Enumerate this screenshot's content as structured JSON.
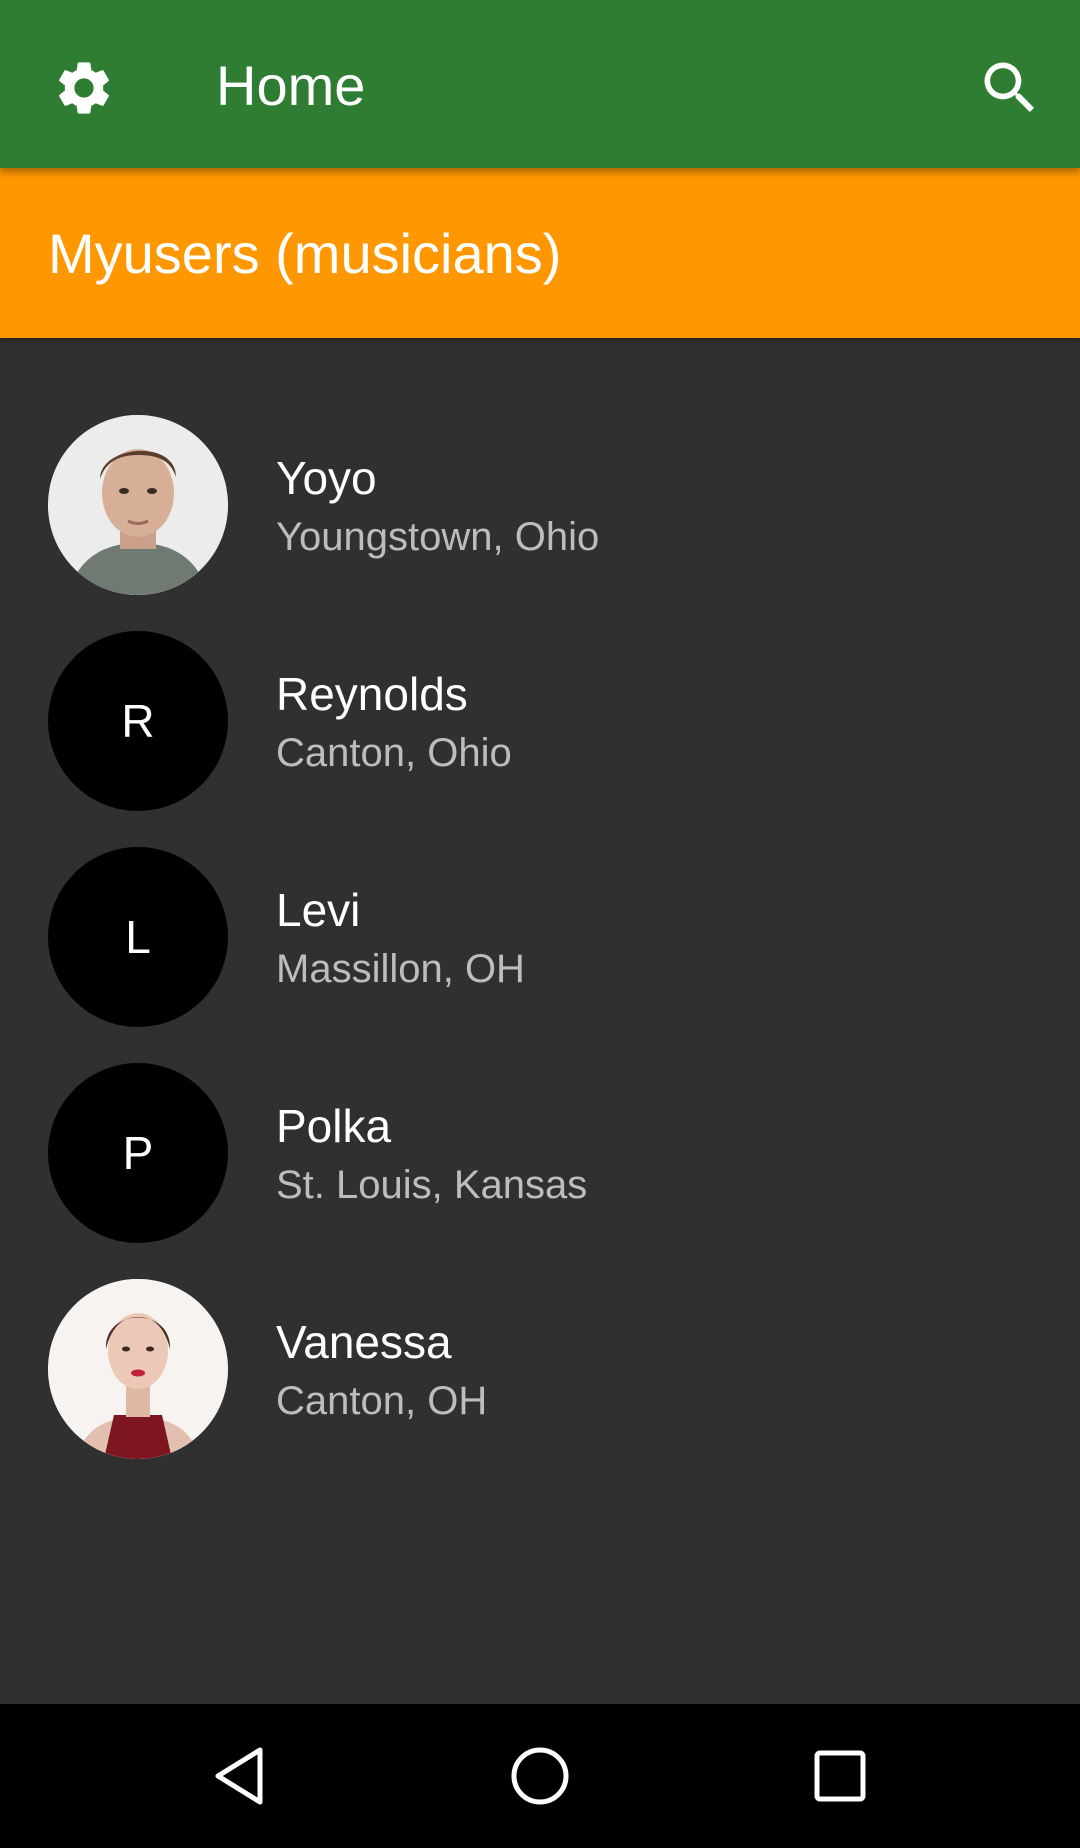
{
  "app_bar": {
    "title": "Home",
    "settings_icon": "gear-icon",
    "search_icon": "search-icon",
    "color": "#2e7d32"
  },
  "header": {
    "title": "Myusers (musicians)",
    "color": "#ff9800"
  },
  "users": [
    {
      "name": "Yoyo",
      "location": "Youngstown, Ohio",
      "avatar": "photo-man",
      "initial": ""
    },
    {
      "name": "Reynolds",
      "location": "Canton, Ohio",
      "avatar": "initial",
      "initial": "R"
    },
    {
      "name": "Levi",
      "location": "Massillon, OH",
      "avatar": "initial",
      "initial": "L"
    },
    {
      "name": "Polka",
      "location": "St. Louis, Kansas",
      "avatar": "initial",
      "initial": "P"
    },
    {
      "name": "Vanessa",
      "location": "Canton, OH",
      "avatar": "photo-woman",
      "initial": ""
    }
  ],
  "nav": {
    "back_icon": "back-triangle-icon",
    "home_icon": "home-circle-icon",
    "recents_icon": "recents-square-icon"
  }
}
